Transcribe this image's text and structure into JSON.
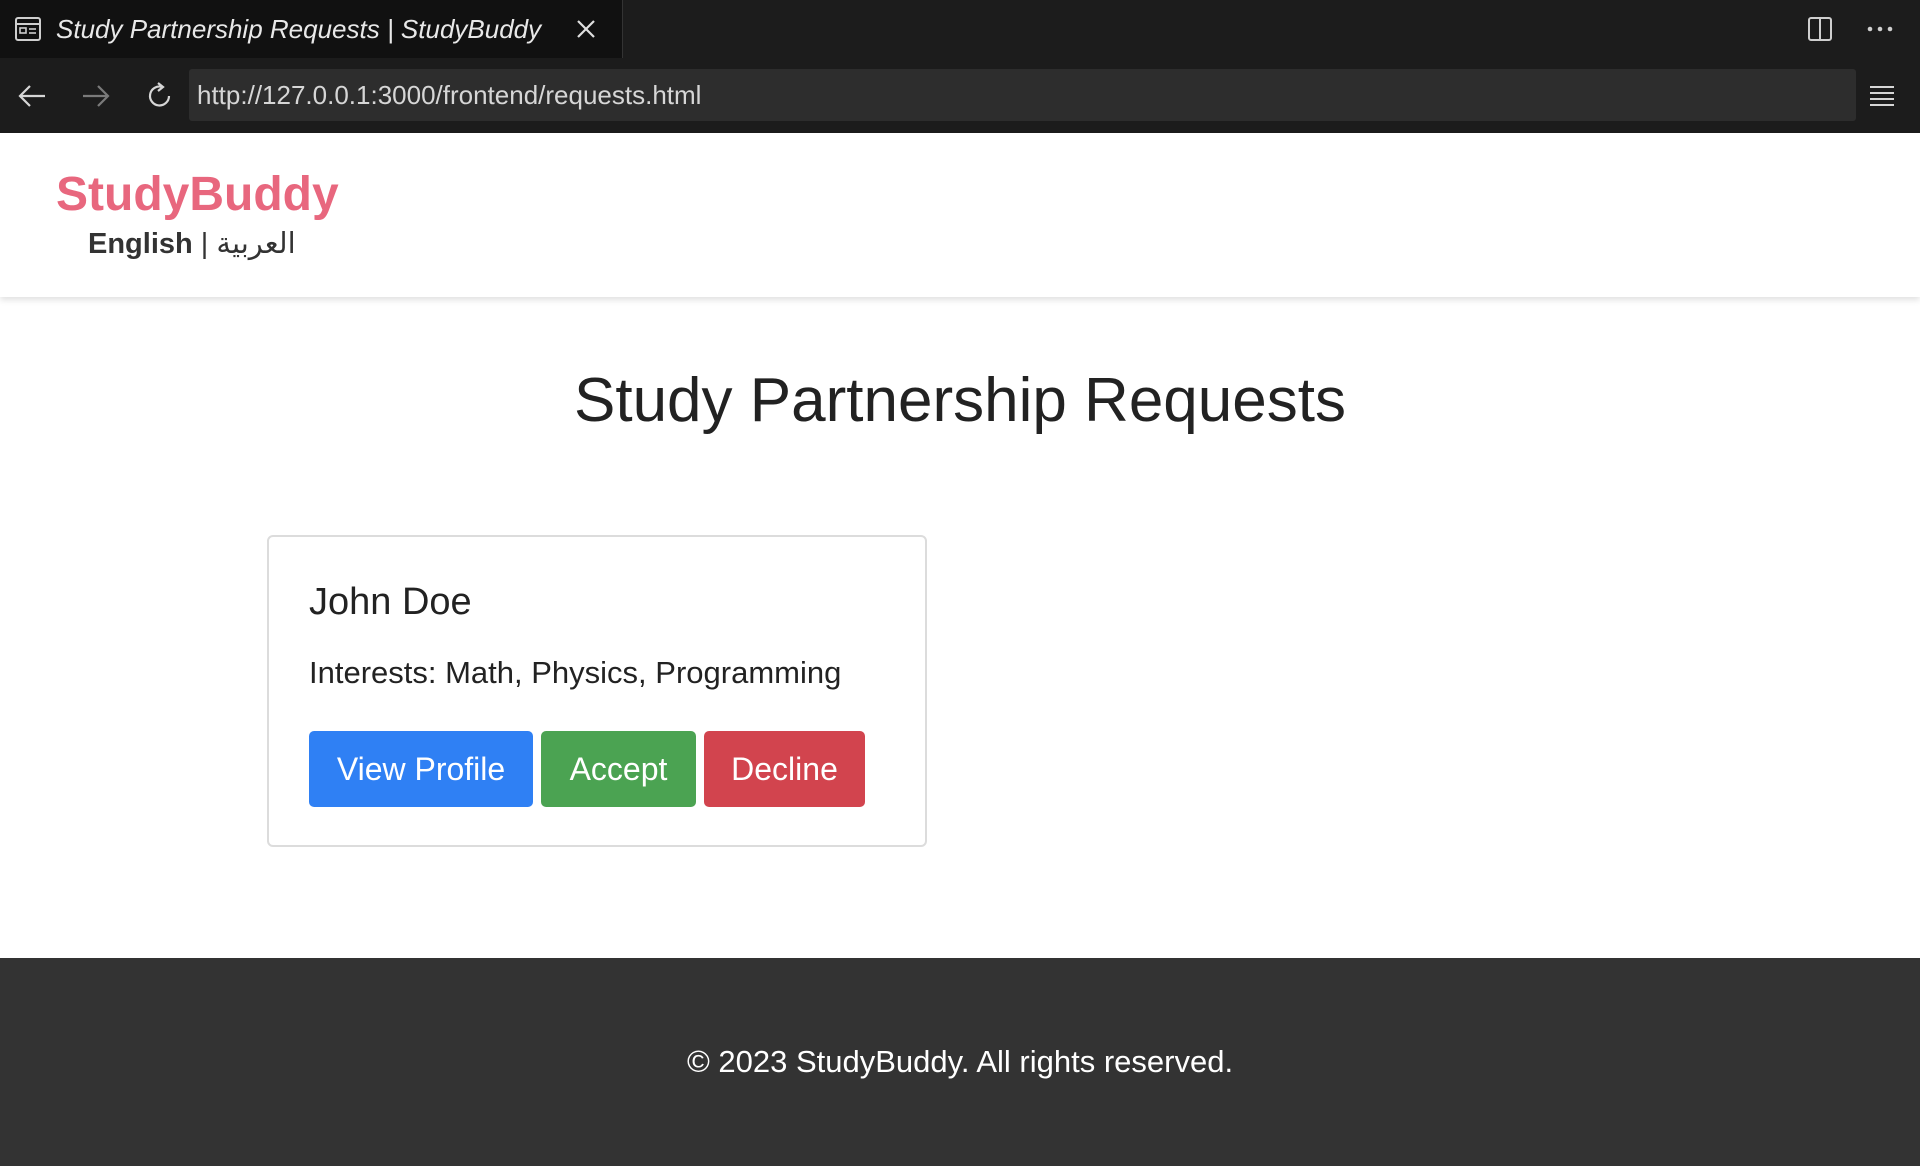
{
  "browser": {
    "tab_title": "Study Partnership Requests | StudyBuddy",
    "url": "http://127.0.0.1:3000/frontend/requests.html"
  },
  "header": {
    "brand": "StudyBuddy",
    "lang_english": "English",
    "lang_separator": "|",
    "lang_arabic": "العربية"
  },
  "main": {
    "title": "Study Partnership Requests",
    "requests": [
      {
        "name": "John Doe",
        "interests": "Interests: Math, Physics, Programming",
        "view_label": "View Profile",
        "accept_label": "Accept",
        "decline_label": "Decline"
      }
    ]
  },
  "footer": {
    "text": "© 2023 StudyBuddy. All rights reserved."
  },
  "colors": {
    "brand": "#e8677e",
    "view": "#2f80f4",
    "accept": "#4ba352",
    "decline": "#d2444e",
    "footer_bg": "#333333"
  }
}
